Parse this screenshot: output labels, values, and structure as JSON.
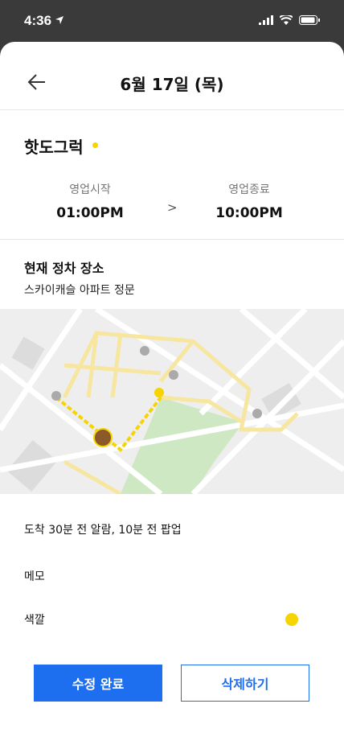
{
  "status": {
    "time": "4:36"
  },
  "header": {
    "title": "6월 17일 (목)"
  },
  "truck": {
    "name": "핫도그럭",
    "accent_color": "#f5d400"
  },
  "hours": {
    "start_label": "영업시작",
    "start_value": "01:00PM",
    "separator": ">",
    "end_label": "영업종료",
    "end_value": "10:00PM"
  },
  "location": {
    "title": "현재 정차 장소",
    "address": "스카이캐슬 아파트 정문"
  },
  "settings": {
    "alarm": "도착 30분 전 알람, 10분 전 팝업",
    "memo_label": "메모",
    "color_label": "색깔",
    "color_value": "#f5d400"
  },
  "actions": {
    "done_label": "수정 완료",
    "delete_label": "삭제하기"
  }
}
